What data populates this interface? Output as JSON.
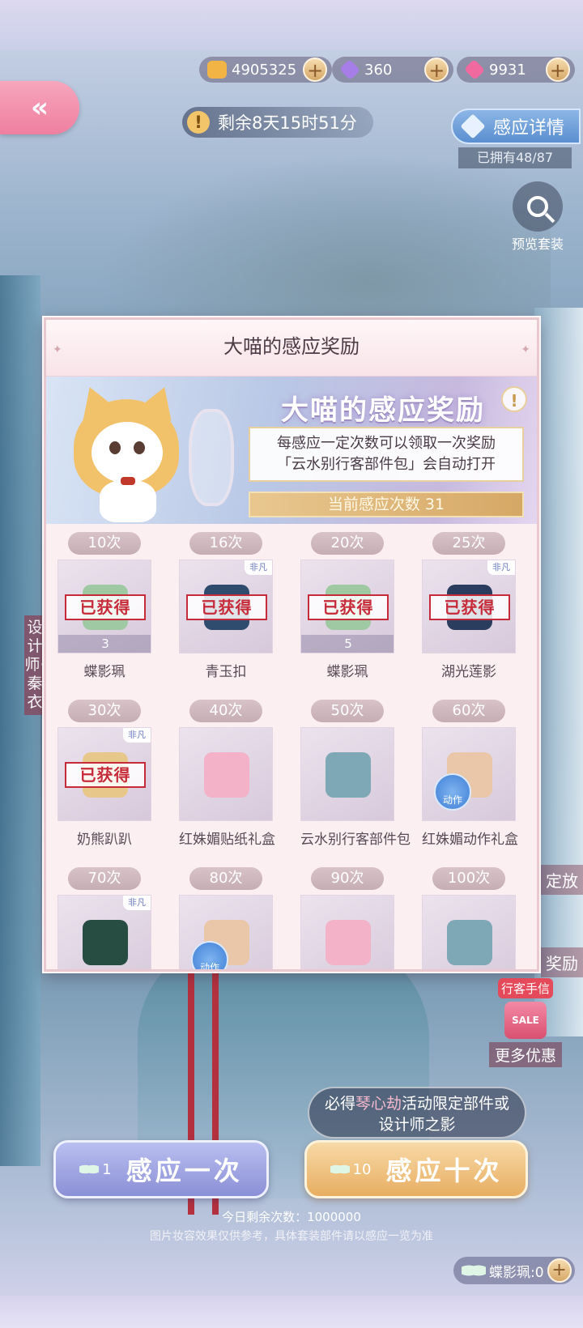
{
  "currency": [
    {
      "icon": "cat-coin-icon",
      "value": "4905325",
      "color": "#f2b545"
    },
    {
      "icon": "purple-diamond-icon",
      "value": "360",
      "color": "#a77ee8"
    },
    {
      "icon": "pink-diamond-icon",
      "value": "9931",
      "color": "#f06aa0"
    }
  ],
  "timer": {
    "text": "剩余8天15时51分"
  },
  "detail_button": {
    "label": "感应详情"
  },
  "owned": {
    "text": "已拥有48/87"
  },
  "preview": {
    "label": "预览套装"
  },
  "side_label": {
    "text": "设计师·秦衣"
  },
  "side_right": {
    "label1": "定放",
    "label2": "奖励"
  },
  "panel": {
    "title": "大喵的感应奖励",
    "banner_title": "大喵的感应奖励",
    "desc_line1": "每感应一定次数可以领取一次奖励",
    "desc_line2": "「云水别行客部件包」会自动打开",
    "count_text": "当前感应次数 31",
    "obtained_stamp": "已获得",
    "rewards": [
      {
        "tag": "10次",
        "name": "蝶影珮",
        "obtained": true,
        "qty": "3",
        "color": "#9fc9a3"
      },
      {
        "tag": "16次",
        "name": "青玉扣",
        "obtained": true,
        "qty": "",
        "color": "#2f4b6e"
      },
      {
        "tag": "20次",
        "name": "蝶影珮",
        "obtained": true,
        "qty": "5",
        "color": "#9fc9a3"
      },
      {
        "tag": "25次",
        "name": "湖光莲影",
        "obtained": true,
        "qty": "",
        "color": "#2b3d5f"
      },
      {
        "tag": "30次",
        "name": "奶熊趴趴",
        "obtained": true,
        "qty": "",
        "color": "#e8c88a"
      },
      {
        "tag": "40次",
        "name": "红姝媚贴纸礼盒",
        "obtained": false,
        "qty": "",
        "color": "#f3b2c8"
      },
      {
        "tag": "50次",
        "name": "云水别行客部件包",
        "obtained": false,
        "qty": "",
        "color": "#7fa8b6"
      },
      {
        "tag": "60次",
        "name": "红姝媚动作礼盒",
        "obtained": false,
        "qty": "",
        "color": "#e9c7a8"
      },
      {
        "tag": "70次",
        "name": "",
        "obtained": false,
        "qty": "",
        "color": "#274d43"
      },
      {
        "tag": "80次",
        "name": "",
        "obtained": false,
        "qty": "",
        "color": "#e9c7a8"
      },
      {
        "tag": "90次",
        "name": "",
        "obtained": false,
        "qty": "",
        "color": "#f3b2c8"
      },
      {
        "tag": "100次",
        "name": "",
        "obtained": false,
        "qty": "",
        "color": "#7fa8b6"
      }
    ],
    "badge_text": "非凡",
    "action_badge_text": "动作"
  },
  "promo": {
    "tag": "行客手信",
    "bag_text": "SALE",
    "label": "更多优惠"
  },
  "hint": {
    "prefix": "必得",
    "highlight": "琴心劫",
    "suffix": "活动限定部件或",
    "line2": "设计师之影"
  },
  "buttons": {
    "once": {
      "cost": "1",
      "label": "感应一次"
    },
    "ten": {
      "cost": "10",
      "label": "感应十次"
    }
  },
  "remaining": {
    "text": "今日剩余次数：1000000"
  },
  "disclaimer": {
    "text": "图片妆容效果仅供参考，具体套装部件请以感应一览为准"
  },
  "token": {
    "label": "蝶影珮:0"
  }
}
